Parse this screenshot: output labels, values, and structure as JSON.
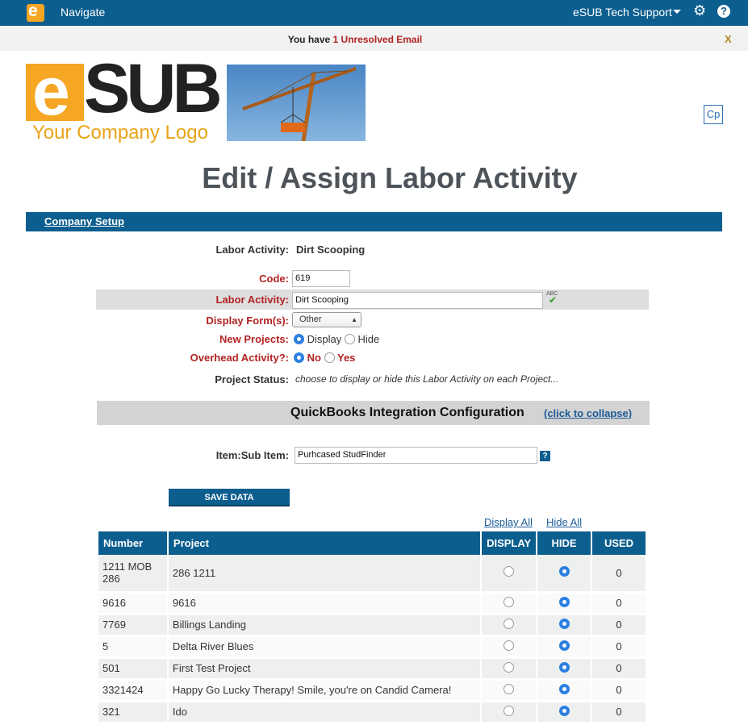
{
  "topbar": {
    "logo_letter": "e",
    "navigate": "Navigate",
    "user": "eSUB Tech Support",
    "gear_icon": "gear-icon",
    "help_icon": "?"
  },
  "notice": {
    "prefix": "You have ",
    "link": "1 Unresolved Email",
    "close": "X"
  },
  "brand": {
    "e": "e",
    "sub": "SUB",
    "tagline": "Your Company Logo",
    "cp": "Cp"
  },
  "page_title": "Edit / Assign Labor Activity",
  "breadcrumb": "Company Setup",
  "form": {
    "labor_activity_header_label": "Labor Activity:",
    "labor_activity_header_value": "Dirt Scooping",
    "code_label": "Code:",
    "code_value": "619",
    "labor_label": "Labor Activity:",
    "labor_value": "Dirt Scooping",
    "spell_label": "ABC",
    "display_forms_label": "Display Form(s):",
    "display_forms_value": "Other",
    "new_projects_label": "New Projects:",
    "new_projects_display": "Display",
    "new_projects_hide": "Hide",
    "overhead_label": "Overhead Activity?:",
    "overhead_no": "No",
    "overhead_yes": "Yes",
    "project_status_label": "Project Status:",
    "project_status_value": "choose to display or hide this Labor Activity on each Project..."
  },
  "quickbooks": {
    "title": "QuickBooks Integration Configuration",
    "collapse": "(click to collapse)",
    "item_label": "Item:Sub Item:",
    "item_value": "Purhcased StudFinder",
    "help": "?"
  },
  "save_button": "SAVE DATA",
  "links": {
    "display_all": "Display All",
    "hide_all": "Hide All"
  },
  "table": {
    "headers": [
      "Number",
      "Project",
      "DISPLAY",
      "HIDE",
      "USED"
    ],
    "rows": [
      {
        "number": "1211 MOB 286",
        "project": "286 1211",
        "display": false,
        "hide": true,
        "used": "0"
      },
      {
        "number": "9616",
        "project": "9616",
        "display": false,
        "hide": true,
        "used": "0"
      },
      {
        "number": "7769",
        "project": "Billings Landing",
        "display": false,
        "hide": true,
        "used": "0"
      },
      {
        "number": "5",
        "project": "Delta River Blues",
        "display": false,
        "hide": true,
        "used": "0"
      },
      {
        "number": "501",
        "project": "First Test Project",
        "display": false,
        "hide": true,
        "used": "0"
      },
      {
        "number": "3321424",
        "project": "Happy Go Lucky Therapy! Smile, you're on Candid Camera!",
        "display": false,
        "hide": true,
        "used": "0"
      },
      {
        "number": "321",
        "project": "Ido",
        "display": false,
        "hide": true,
        "used": "0"
      }
    ]
  }
}
